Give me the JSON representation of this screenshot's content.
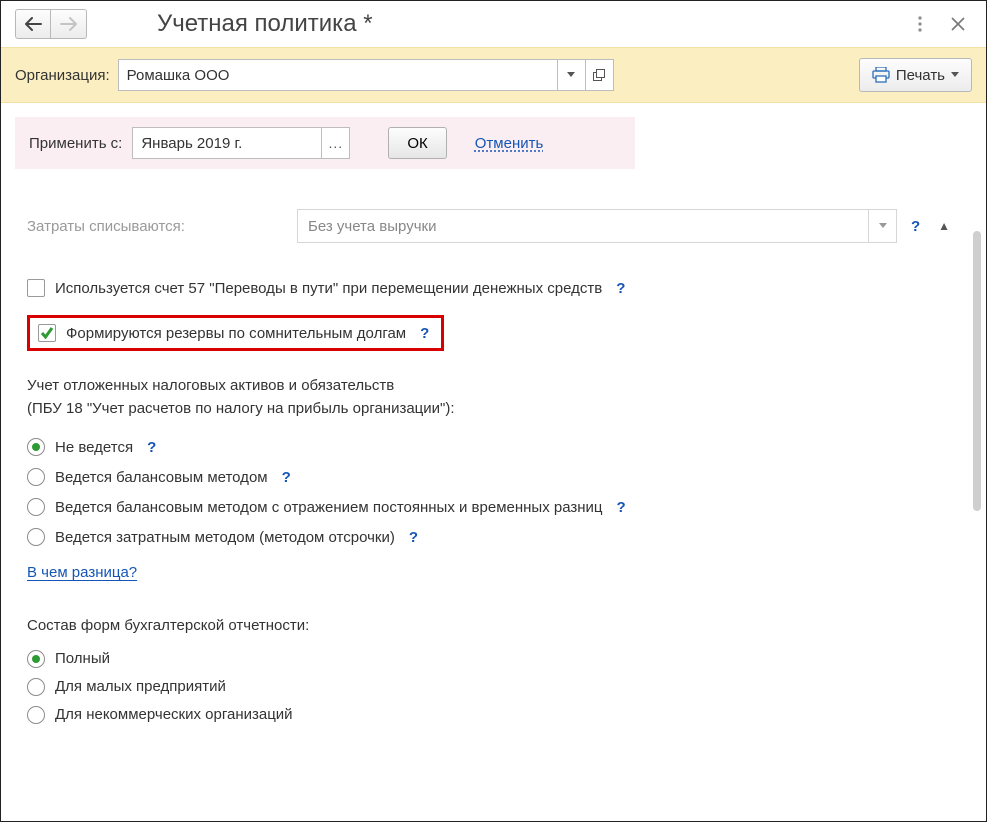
{
  "title": "Учетная политика *",
  "toolbar": {
    "org_label": "Организация:",
    "org_value": "Ромашка ООО",
    "print_label": "Печать"
  },
  "apply": {
    "label": "Применить с:",
    "date_value": "Январь 2019 г.",
    "ok_label": "ОК",
    "cancel_label": "Отменить"
  },
  "expenses": {
    "label": "Затраты списываются:",
    "value": "Без учета выручки"
  },
  "checkboxes": {
    "account57": {
      "label": "Используется счет 57 \"Переводы в пути\" при перемещении денежных средств",
      "checked": false
    },
    "reserves": {
      "label": "Формируются резервы по сомнительным долгам",
      "checked": true
    }
  },
  "tax_block": {
    "line1": "Учет отложенных налоговых активов и обязательств",
    "line2": "(ПБУ 18 \"Учет расчетов по налогу на прибыль организации\"):",
    "options": [
      "Не ведется",
      "Ведется балансовым методом",
      "Ведется балансовым методом с отражением постоянных и временных разниц",
      "Ведется затратным методом (методом отсрочки)"
    ],
    "selected": 0,
    "diff_link": "В чем разница?"
  },
  "report_forms": {
    "label": "Состав форм бухгалтерской отчетности:",
    "options": [
      "Полный",
      "Для малых предприятий",
      "Для некоммерческих организаций"
    ],
    "selected": 0
  },
  "help_glyph": "?"
}
